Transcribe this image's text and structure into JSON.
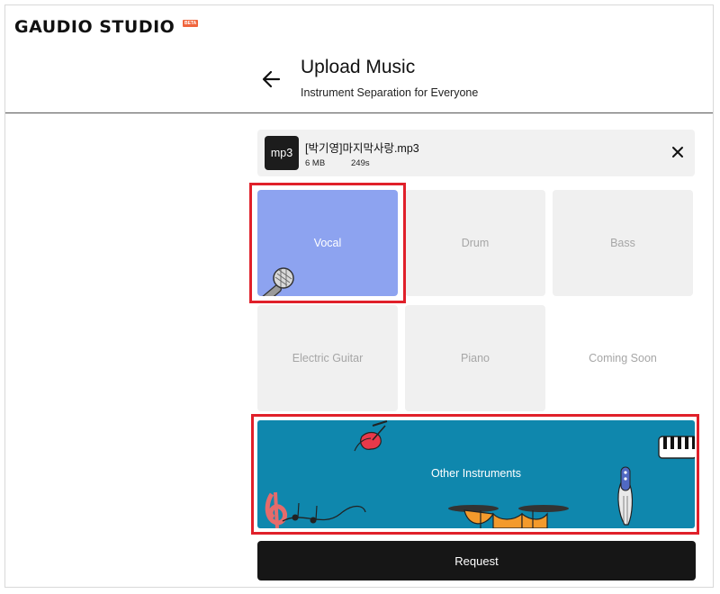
{
  "app": {
    "logo_text": "GAUDIO STUDIO",
    "badge": "BETA"
  },
  "header": {
    "title": "Upload Music",
    "subtitle": "Instrument Separation for Everyone"
  },
  "file": {
    "type_label": "mp3",
    "name": "[박기영]마지막사랑.mp3",
    "size": "6 MB",
    "duration": "249s"
  },
  "instruments": [
    {
      "label": "Vocal",
      "state": "selected"
    },
    {
      "label": "Drum",
      "state": "available"
    },
    {
      "label": "Bass",
      "state": "available"
    },
    {
      "label": "Electric Guitar",
      "state": "available"
    },
    {
      "label": "Piano",
      "state": "available"
    },
    {
      "label": "Coming Soon",
      "state": "disabled"
    }
  ],
  "other": {
    "label": "Other Instruments",
    "state": "selected"
  },
  "actions": {
    "request_label": "Request"
  },
  "colors": {
    "selected_tile": "#8da3f0",
    "other_instruments_bg": "#0f87ad",
    "highlight_border": "#e0202a",
    "request_button": "#161616",
    "badge": "#f0653d"
  },
  "icons": [
    "back-arrow-icon",
    "close-icon",
    "microphone-icon",
    "guitar-icon",
    "piano-keys-icon",
    "bass-guitar-icon",
    "treble-clef-icon",
    "drum-kit-icon"
  ]
}
